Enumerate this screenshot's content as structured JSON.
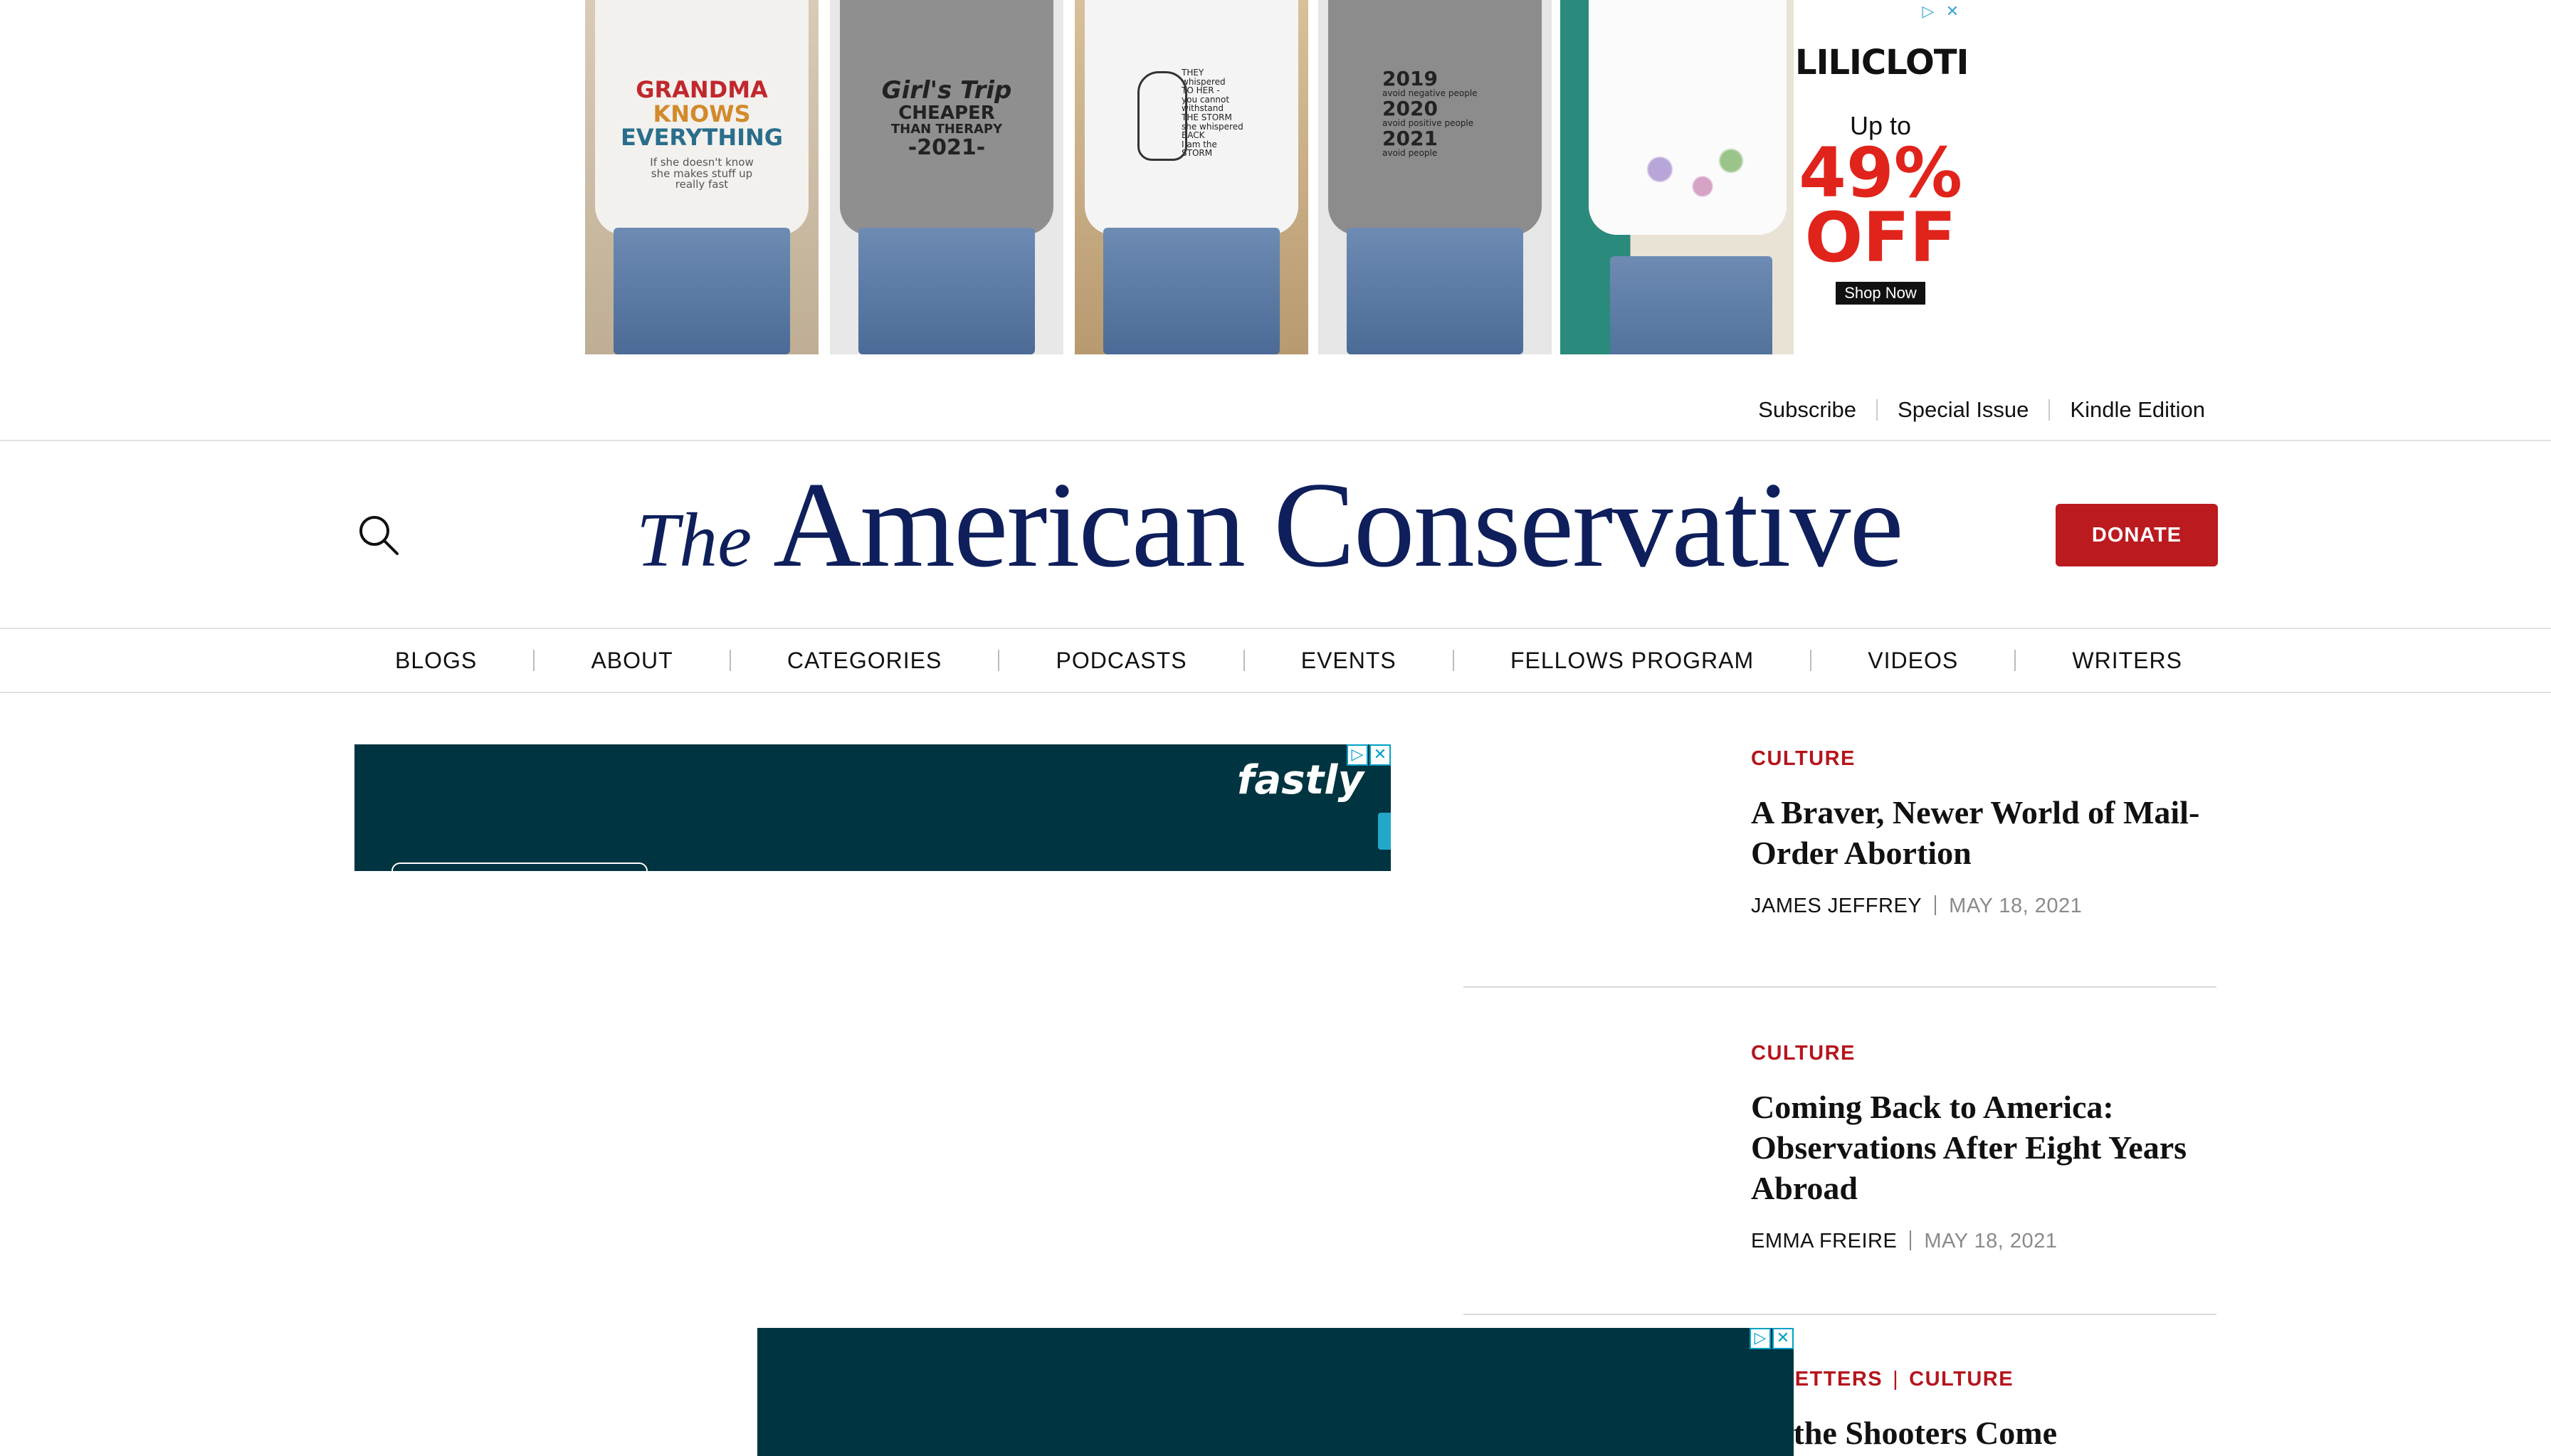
{
  "top_ad": {
    "panels": [
      {
        "print_lines": [
          "GRANDMA",
          "KNOWS",
          "EVERYTHING"
        ],
        "small_lines": [
          "If she doesn't know",
          "she makes stuff up",
          "really fast"
        ]
      },
      {
        "print_lines": [
          "Girl's Trip",
          "CHEAPER",
          "THAN THERAPY",
          "-2021-"
        ]
      },
      {
        "print_lines": [
          "THEY",
          "whispered",
          "TO HER -",
          "you cannot",
          "withstand",
          "THE STORM",
          "she whispered",
          "BACK",
          "I am the",
          "STORM"
        ]
      },
      {
        "print_lines": [
          "2019",
          "avoid negative people",
          "2020",
          "avoid positive people",
          "2021",
          "avoid people"
        ]
      },
      {
        "print_lines": []
      }
    ],
    "brand": "LILICLOTH",
    "up_to": "Up to",
    "percent": "49%",
    "off": "OFF",
    "cta": "Shop Now"
  },
  "utility_nav": {
    "subscribe": "Subscribe",
    "special_issue": "Special Issue",
    "kindle": "Kindle Edition"
  },
  "masthead": {
    "the": "The",
    "name": "American Conservative"
  },
  "donate_label": "DONATE",
  "nav": [
    "BLOGS",
    "ABOUT",
    "CATEGORIES",
    "PODCASTS",
    "EVENTS",
    "FELLOWS PROGRAM",
    "VIDEOS",
    "WRITERS"
  ],
  "fastly_ad": {
    "logo": "fastly"
  },
  "articles": [
    {
      "categories": [
        "CULTURE"
      ],
      "title": "A Braver, Newer World of Mail-Order Abortion",
      "author": "JAMES JEFFREY",
      "date": "MAY 18, 2021"
    },
    {
      "categories": [
        "CULTURE"
      ],
      "title": "Coming Back to America: Observations After Eight Years Abroad",
      "author": "EMMA FREIRE",
      "date": "MAY 18, 2021"
    },
    {
      "categories": [
        "ARTS & LETTERS",
        "CULTURE"
      ],
      "title": "Where the Shooters Come"
    }
  ],
  "colors": {
    "brand_navy": "#0e1f5c",
    "accent_red": "#bb1a1f",
    "ad_teal": "#003440"
  }
}
